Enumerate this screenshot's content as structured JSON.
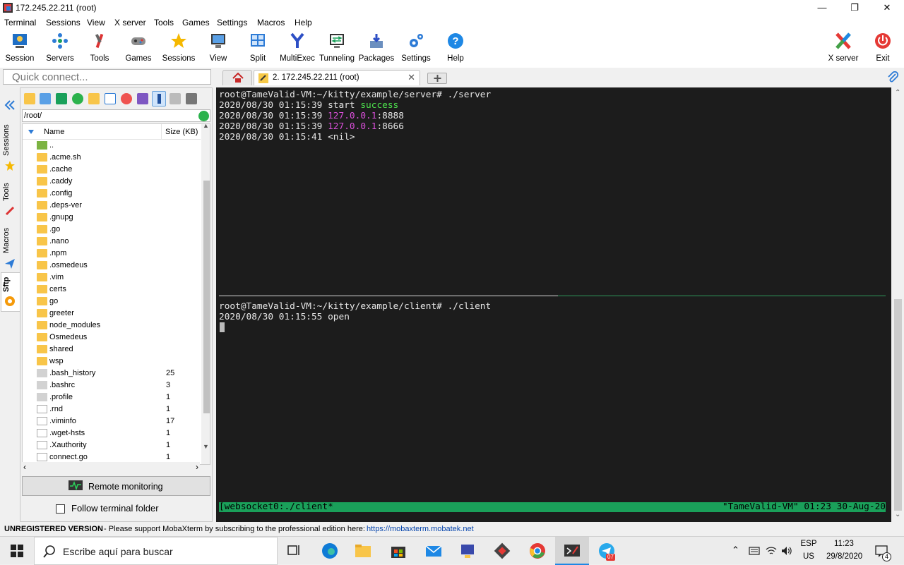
{
  "window": {
    "title": "172.245.22.211 (root)"
  },
  "menu": [
    "Terminal",
    "Sessions",
    "View",
    "X server",
    "Tools",
    "Games",
    "Settings",
    "Macros",
    "Help"
  ],
  "toolbar": [
    {
      "label": "Session",
      "icon": "session-icon"
    },
    {
      "label": "Servers",
      "icon": "servers-icon"
    },
    {
      "label": "Tools",
      "icon": "tools-icon"
    },
    {
      "label": "Games",
      "icon": "games-icon"
    },
    {
      "label": "Sessions",
      "icon": "star-icon"
    },
    {
      "label": "View",
      "icon": "view-icon"
    },
    {
      "label": "Split",
      "icon": "split-icon"
    },
    {
      "label": "MultiExec",
      "icon": "multiexec-icon"
    },
    {
      "label": "Tunneling",
      "icon": "tunneling-icon"
    },
    {
      "label": "Packages",
      "icon": "packages-icon"
    },
    {
      "label": "Settings",
      "icon": "settings-icon"
    },
    {
      "label": "Help",
      "icon": "help-icon"
    }
  ],
  "toolbar_right": {
    "xserver": "X server",
    "exit": "Exit"
  },
  "quick_connect": {
    "placeholder": "Quick connect..."
  },
  "tab": {
    "label": "2. 172.245.22.211 (root)"
  },
  "side_tabs": [
    "Sessions",
    "Tools",
    "Macros",
    "Sftp"
  ],
  "sftp": {
    "path": "/root/",
    "col_name": "Name",
    "col_size": "Size (KB)",
    "files": [
      {
        "name": "..",
        "size": "",
        "type": "up"
      },
      {
        "name": ".acme.sh",
        "size": "",
        "type": "folder"
      },
      {
        "name": ".cache",
        "size": "",
        "type": "folder"
      },
      {
        "name": ".caddy",
        "size": "",
        "type": "folder"
      },
      {
        "name": ".config",
        "size": "",
        "type": "folder"
      },
      {
        "name": ".deps-ver",
        "size": "",
        "type": "folder"
      },
      {
        "name": ".gnupg",
        "size": "",
        "type": "folder"
      },
      {
        "name": ".go",
        "size": "",
        "type": "folder"
      },
      {
        "name": ".nano",
        "size": "",
        "type": "folder"
      },
      {
        "name": ".npm",
        "size": "",
        "type": "folder"
      },
      {
        "name": ".osmedeus",
        "size": "",
        "type": "folder"
      },
      {
        "name": ".vim",
        "size": "",
        "type": "folder"
      },
      {
        "name": "certs",
        "size": "",
        "type": "folder"
      },
      {
        "name": "go",
        "size": "",
        "type": "folder"
      },
      {
        "name": "greeter",
        "size": "",
        "type": "folder"
      },
      {
        "name": "node_modules",
        "size": "",
        "type": "folder"
      },
      {
        "name": "Osmedeus",
        "size": "",
        "type": "folder"
      },
      {
        "name": "shared",
        "size": "",
        "type": "folder"
      },
      {
        "name": "wsp",
        "size": "",
        "type": "folder"
      },
      {
        "name": ".bash_history",
        "size": "25",
        "type": "grey"
      },
      {
        "name": ".bashrc",
        "size": "3",
        "type": "grey"
      },
      {
        "name": ".profile",
        "size": "1",
        "type": "grey"
      },
      {
        "name": ".rnd",
        "size": "1",
        "type": "doc"
      },
      {
        "name": ".viminfo",
        "size": "17",
        "type": "doc"
      },
      {
        "name": ".wget-hsts",
        "size": "1",
        "type": "doc"
      },
      {
        "name": ".Xauthority",
        "size": "1",
        "type": "doc"
      },
      {
        "name": "connect.go",
        "size": "1",
        "type": "doc"
      }
    ],
    "remote_monitoring": "Remote monitoring",
    "follow_folder": "Follow terminal folder"
  },
  "terminal": {
    "top": {
      "prompt": "root@TameValid-VM:~/kitty/example/server# ./server",
      "l1_ts": "2020/08/30 01:15:39 start ",
      "l1_hl": "success",
      "l2_ts": "2020/08/30 01:15:39 ",
      "l2_ip": "127.0.0.1",
      "l2_port": ":8888",
      "l3_ts": "2020/08/30 01:15:39 ",
      "l3_ip": "127.0.0.1",
      "l3_port": ":8666",
      "l4": "2020/08/30 01:15:41 <nil>"
    },
    "bottom": {
      "prompt": "root@TameValid-VM:~/kitty/example/client# ./client",
      "l1": "2020/08/30 01:15:55 open"
    },
    "status_left": "[websocket0:./client*",
    "status_right": "\"TameValid-VM\" 01:23 30-Aug-20"
  },
  "statusbar": {
    "bold": "UNREGISTERED VERSION",
    "text": " -  Please support MobaXterm by subscribing to the professional edition here:",
    "link": "https://mobaxterm.mobatek.net"
  },
  "taskbar": {
    "search": "Escribe aquí para buscar",
    "lang1": "ESP",
    "lang2": "US",
    "time": "11:23",
    "date": "29/8/2020",
    "notif": "4",
    "telegram_badge": "07"
  },
  "colors": {
    "accent": "#1aa05a",
    "terminal_bg": "#1c1c1c",
    "success": "#4ee44e",
    "ip": "#d94fd9"
  }
}
